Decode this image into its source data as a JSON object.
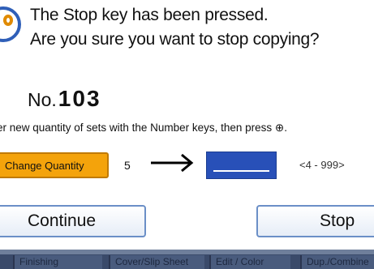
{
  "dialog": {
    "line1": "The Stop key has been pressed.",
    "line2": "Are you sure you want to stop copying?",
    "job_prefix": "No.",
    "job_number": "103",
    "instruction": "er new quantity of sets with the Number keys, then press ⊕.",
    "change_quantity_label": "Change Quantity",
    "current_quantity": "5",
    "arrow": "→",
    "new_quantity": "",
    "range": "<4 - 999>",
    "continue_label": "Continue",
    "stop_label": "Stop"
  },
  "tabs": [
    "Finishing",
    "Cover/Slip Sheet",
    "Edit / Color",
    "Dup./Combine"
  ],
  "colors": {
    "accent_orange": "#f4a30b",
    "input_blue": "#2850b8",
    "button_border": "#6b8fc7"
  },
  "icons": [
    "question-icon",
    "arrow-right-icon",
    "start-key-icon"
  ]
}
